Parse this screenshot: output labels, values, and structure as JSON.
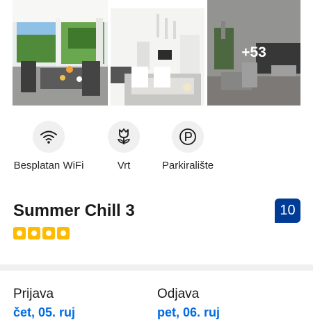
{
  "gallery": {
    "photos": [
      {
        "name": "terrace dining photo"
      },
      {
        "name": "dining and kitchen photo"
      },
      {
        "name": "living room photo"
      }
    ],
    "more_count": "+53"
  },
  "amenities": [
    {
      "icon": "wifi-icon",
      "label": "Besplatan WiFi"
    },
    {
      "icon": "flower-icon",
      "label": "Vrt"
    },
    {
      "icon": "parking-icon",
      "label": "Parkiralište"
    }
  ],
  "property": {
    "name": "Summer Chill 3",
    "stars": 4,
    "star_color": "#febb02",
    "score": "10",
    "score_color": "#003b95"
  },
  "dates": {
    "checkin_label": "Prijava",
    "checkin_value": "čet, 05. ruj",
    "checkout_label": "Odjava",
    "checkout_value": "pet, 06. ruj",
    "value_color": "#006ce4"
  }
}
